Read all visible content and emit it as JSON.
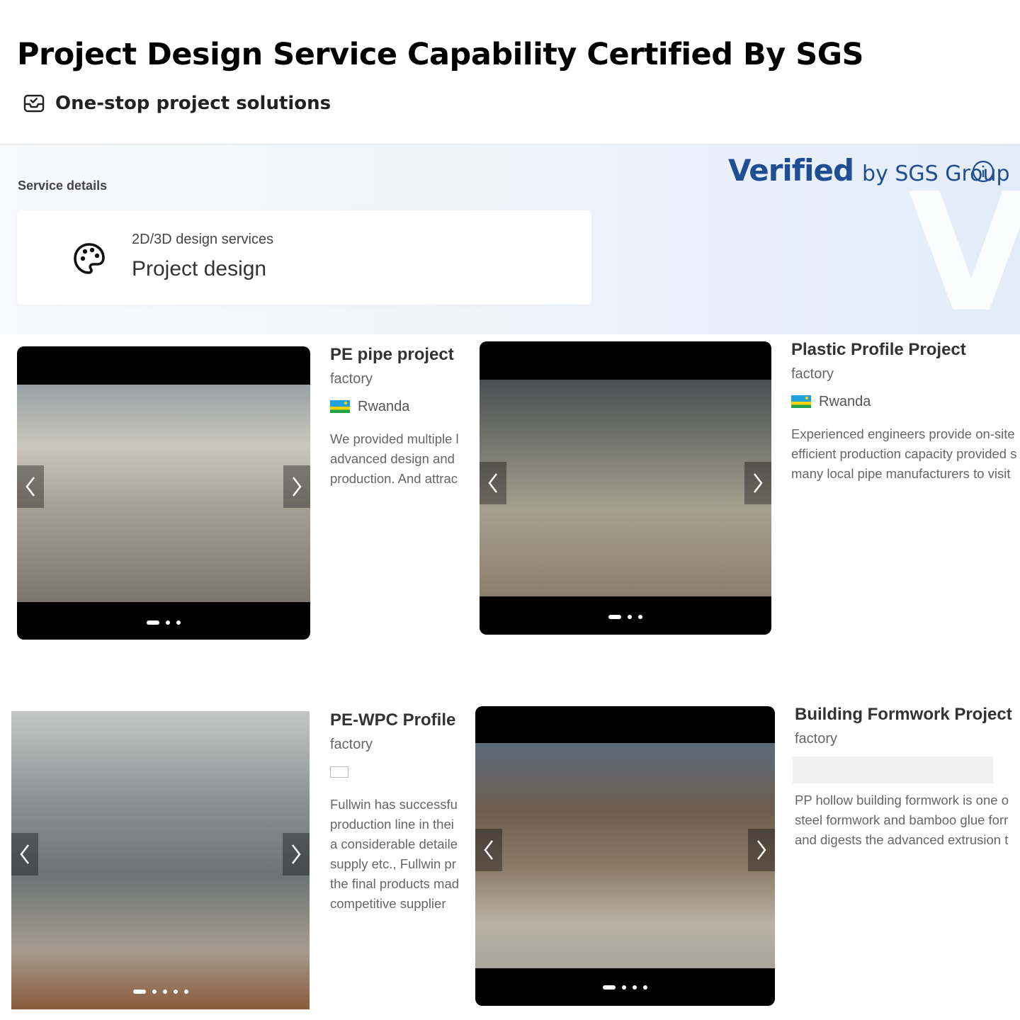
{
  "header": {
    "title": "Project Design Service Capability Certified By SGS",
    "subtitle": "One-stop project solutions",
    "subtitle_icon": "verified-box-icon"
  },
  "sgs": {
    "section_label": "Service details",
    "verified_word": "Verified",
    "verified_by": "by SGS Group",
    "info_icon": "info-icon",
    "service": {
      "icon": "palette-icon",
      "label": "2D/3D design services",
      "value": "Project design"
    }
  },
  "projects": [
    {
      "title": "PE pipe project",
      "type": "factory",
      "country": "Rwanda",
      "flag": "rwanda-flag",
      "description_lines": [
        "We provided multiple l",
        "advanced design and",
        "production. And attrac"
      ],
      "dots": 3,
      "active_dot": 0
    },
    {
      "title": "Plastic Profile Project",
      "type": "factory",
      "country": "Rwanda",
      "flag": "rwanda-flag",
      "description_lines": [
        "Experienced engineers provide on-site",
        "efficient production capacity provided s",
        "many local pipe manufacturers to visit"
      ],
      "dots": 3,
      "active_dot": 0
    },
    {
      "title": "PE-WPC Profile",
      "type": "factory",
      "country": "",
      "flag": "blank-flag",
      "description_lines": [
        "Fullwin has successfu",
        "production line in thei",
        "a considerable detaile",
        "supply etc., Fullwin pr",
        "the final products mad",
        "competitive supplier"
      ],
      "dots": 5,
      "active_dot": 0
    },
    {
      "title": "Building Formwork Project",
      "type": "factory",
      "country": "",
      "flag": "",
      "description_lines": [
        "PP hollow building formwork is one o",
        "steel formwork and bamboo glue forr",
        "and digests the advanced extrusion t"
      ],
      "dots": 4,
      "active_dot": 0
    }
  ],
  "colors": {
    "verified_blue": "#1f4e94",
    "panel_bg": "#eef3fb",
    "title_text": "#000000"
  }
}
